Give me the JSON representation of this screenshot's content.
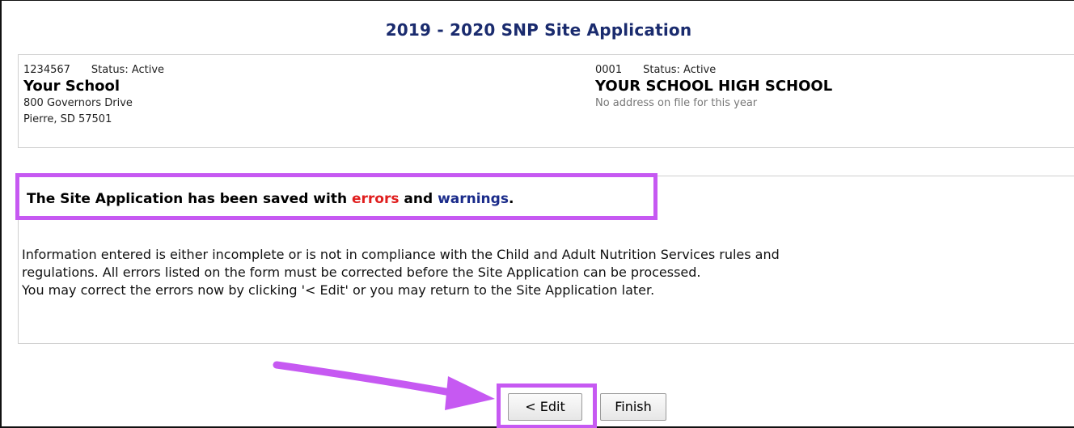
{
  "page": {
    "title": "2019 - 2020 SNP Site Application"
  },
  "sponsor": {
    "id": "1234567",
    "status": "Status: Active",
    "name": "Your School",
    "address_line1": "800 Governors Drive",
    "address_line2": "Pierre, SD 57501"
  },
  "site": {
    "id": "0001",
    "status": "Status: Active",
    "name": "YOUR SCHOOL HIGH SCHOOL",
    "address_note": "No address on file for this year"
  },
  "message": {
    "headline_prefix": "The Site Application has been saved with ",
    "errors_word": "errors",
    "and_word": " and ",
    "warnings_word": "warnings",
    "period": ".",
    "body_line1": "Information entered is either incomplete or is not in compliance with the Child and Adult Nutrition Services rules and",
    "body_line2": "regulations. All errors listed on the form must be corrected before the Site Application can be processed.",
    "body_line3": "You may correct the errors now by clicking '< Edit' or you may return to the Site Application later."
  },
  "buttons": {
    "edit_label": "< Edit",
    "finish_label": "Finish"
  },
  "colors": {
    "title": "#1a2b6e",
    "errors": "#e01e1e",
    "warnings": "#1a2b8a",
    "highlight": "#c659f2"
  },
  "icons": {
    "annotation": "arrow-right-icon"
  }
}
